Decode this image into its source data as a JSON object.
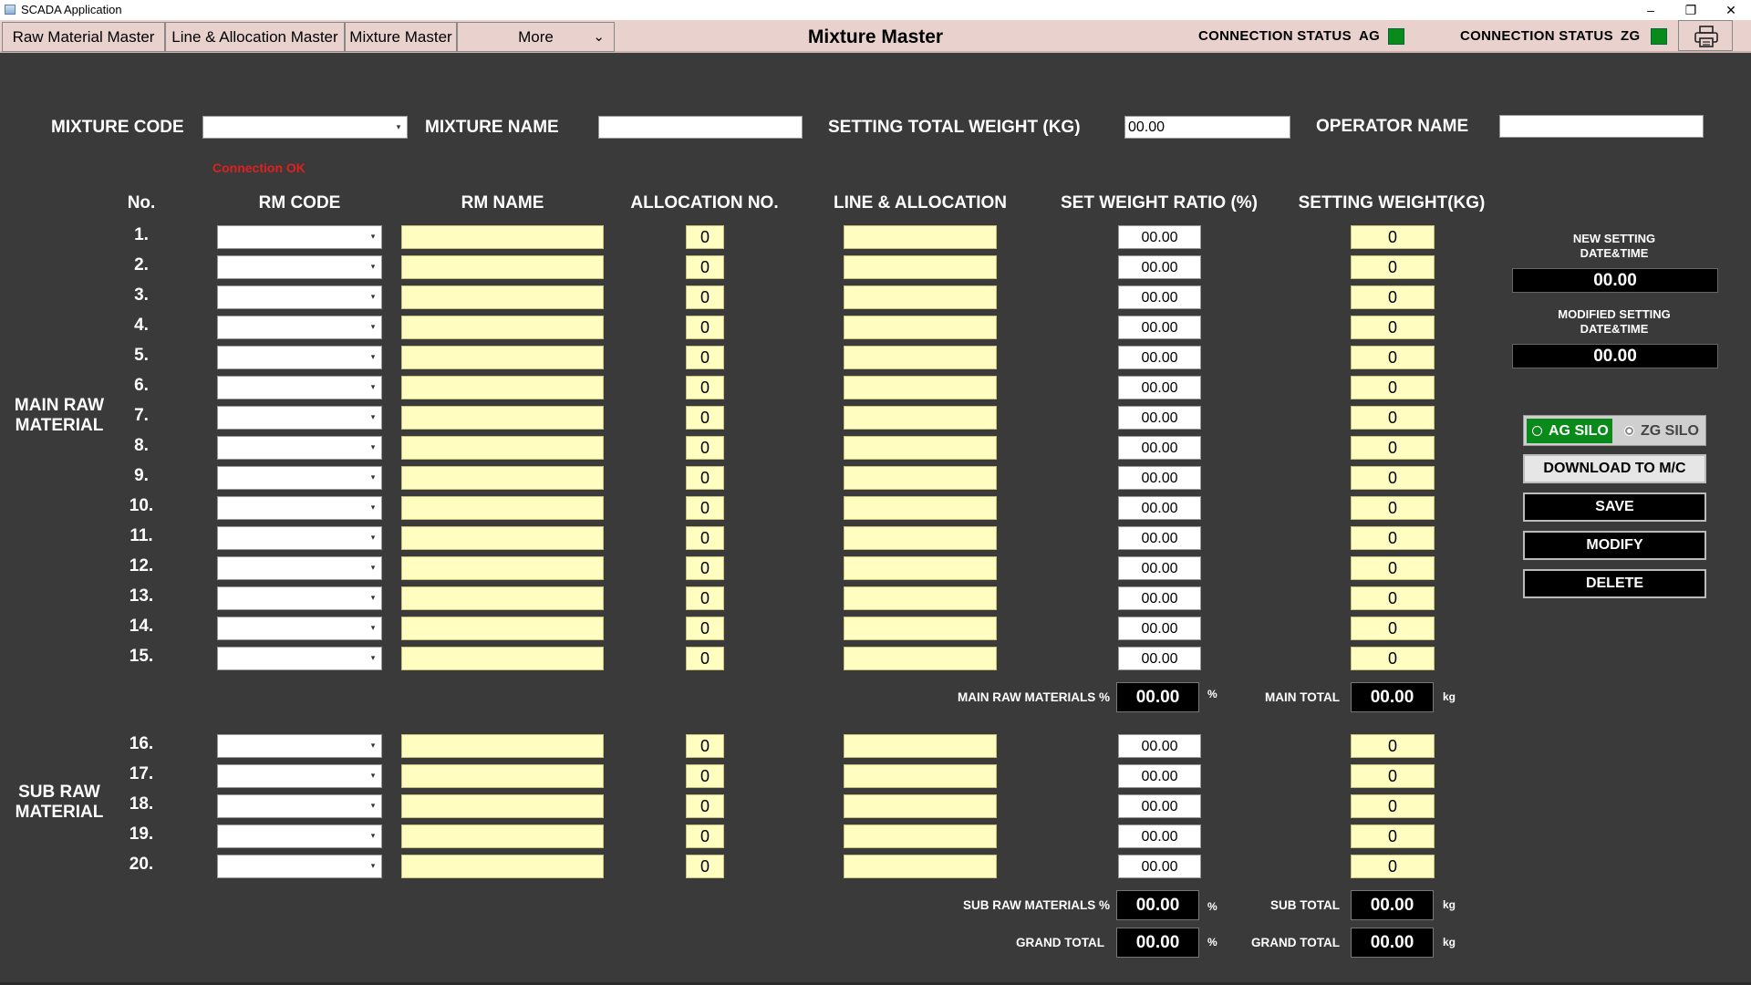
{
  "window": {
    "title": "SCADA Application",
    "minimize": "–",
    "restore": "❐",
    "close": "✕"
  },
  "menu": {
    "tabs": [
      "Raw Material Master",
      "Line & Allocation Master",
      "Mixture Master",
      "More"
    ],
    "page_title": "Mixture Master",
    "connection": [
      {
        "label": "CONNECTION STATUS",
        "code": "AG",
        "color": "#0a8a1a"
      },
      {
        "label": "CONNECTION STATUS",
        "code": "ZG",
        "color": "#0a8a1a"
      }
    ],
    "print_icon": "printer-icon"
  },
  "form": {
    "mixture_code_label": "MIXTURE CODE",
    "mixture_code_value": "",
    "mixture_name_label": "MIXTURE NAME",
    "mixture_name_value": "",
    "total_weight_label": "SETTING TOTAL WEIGHT (KG)",
    "total_weight_value": "00.00",
    "operator_label": "OPERATOR NAME",
    "operator_value": "",
    "status_message": "Connection OK"
  },
  "table": {
    "headers": [
      "No.",
      "RM CODE",
      "RM NAME",
      "ALLOCATION NO.",
      "LINE & ALLOCATION",
      "SET WEIGHT RATIO (%)",
      "SETTING WEIGHT(KG)"
    ],
    "main_label": "MAIN RAW MATERIAL",
    "sub_label": "SUB RAW MATERIAL",
    "main_rows": [
      {
        "no": "1.",
        "rm_code": "",
        "rm_name": "",
        "alloc": "0",
        "line": "",
        "ratio": "00.00",
        "weight": "0"
      },
      {
        "no": "2.",
        "rm_code": "",
        "rm_name": "",
        "alloc": "0",
        "line": "",
        "ratio": "00.00",
        "weight": "0"
      },
      {
        "no": "3.",
        "rm_code": "",
        "rm_name": "",
        "alloc": "0",
        "line": "",
        "ratio": "00.00",
        "weight": "0"
      },
      {
        "no": "4.",
        "rm_code": "",
        "rm_name": "",
        "alloc": "0",
        "line": "",
        "ratio": "00.00",
        "weight": "0"
      },
      {
        "no": "5.",
        "rm_code": "",
        "rm_name": "",
        "alloc": "0",
        "line": "",
        "ratio": "00.00",
        "weight": "0"
      },
      {
        "no": "6.",
        "rm_code": "",
        "rm_name": "",
        "alloc": "0",
        "line": "",
        "ratio": "00.00",
        "weight": "0"
      },
      {
        "no": "7.",
        "rm_code": "",
        "rm_name": "",
        "alloc": "0",
        "line": "",
        "ratio": "00.00",
        "weight": "0"
      },
      {
        "no": "8.",
        "rm_code": "",
        "rm_name": "",
        "alloc": "0",
        "line": "",
        "ratio": "00.00",
        "weight": "0"
      },
      {
        "no": "9.",
        "rm_code": "",
        "rm_name": "",
        "alloc": "0",
        "line": "",
        "ratio": "00.00",
        "weight": "0"
      },
      {
        "no": "10.",
        "rm_code": "",
        "rm_name": "",
        "alloc": "0",
        "line": "",
        "ratio": "00.00",
        "weight": "0"
      },
      {
        "no": "11.",
        "rm_code": "",
        "rm_name": "",
        "alloc": "0",
        "line": "",
        "ratio": "00.00",
        "weight": "0"
      },
      {
        "no": "12.",
        "rm_code": "",
        "rm_name": "",
        "alloc": "0",
        "line": "",
        "ratio": "00.00",
        "weight": "0"
      },
      {
        "no": "13.",
        "rm_code": "",
        "rm_name": "",
        "alloc": "0",
        "line": "",
        "ratio": "00.00",
        "weight": "0"
      },
      {
        "no": "14.",
        "rm_code": "",
        "rm_name": "",
        "alloc": "0",
        "line": "",
        "ratio": "00.00",
        "weight": "0"
      },
      {
        "no": "15.",
        "rm_code": "",
        "rm_name": "",
        "alloc": "0",
        "line": "",
        "ratio": "00.00",
        "weight": "0"
      }
    ],
    "sub_rows": [
      {
        "no": "16.",
        "rm_code": "",
        "rm_name": "",
        "alloc": "0",
        "line": "",
        "ratio": "00.00",
        "weight": "0"
      },
      {
        "no": "17.",
        "rm_code": "",
        "rm_name": "",
        "alloc": "0",
        "line": "",
        "ratio": "00.00",
        "weight": "0"
      },
      {
        "no": "18.",
        "rm_code": "",
        "rm_name": "",
        "alloc": "0",
        "line": "",
        "ratio": "00.00",
        "weight": "0"
      },
      {
        "no": "19.",
        "rm_code": "",
        "rm_name": "",
        "alloc": "0",
        "line": "",
        "ratio": "00.00",
        "weight": "0"
      },
      {
        "no": "20.",
        "rm_code": "",
        "rm_name": "",
        "alloc": "0",
        "line": "",
        "ratio": "00.00",
        "weight": "0"
      }
    ]
  },
  "totals": {
    "main_pct_label": "MAIN RAW MATERIALS %",
    "main_pct": "00.00",
    "main_total_label": "MAIN TOTAL",
    "main_total": "00.00",
    "sub_pct_label": "SUB RAW MATERIALS %",
    "sub_pct": "00.00",
    "sub_total_label": "SUB TOTAL",
    "sub_total": "00.00",
    "grand_pct_label": "GRAND TOTAL",
    "grand_pct": "00.00",
    "grand_total_label": "GRAND TOTAL",
    "grand_total": "00.00",
    "pct_unit": "%",
    "kg_unit": "kg"
  },
  "side": {
    "new_dt_label": "NEW SETTING\nDATE&TIME",
    "new_dt": "00.00",
    "mod_dt_label": "MODIFIED SETTING\nDATE&TIME",
    "mod_dt": "00.00",
    "silo_ag": "AG SILO",
    "silo_zg": "ZG SILO",
    "download": "DOWNLOAD TO M/C",
    "save": "SAVE",
    "modify": "MODIFY",
    "delete": "DELETE",
    "active_color": "#0a8a1a"
  }
}
